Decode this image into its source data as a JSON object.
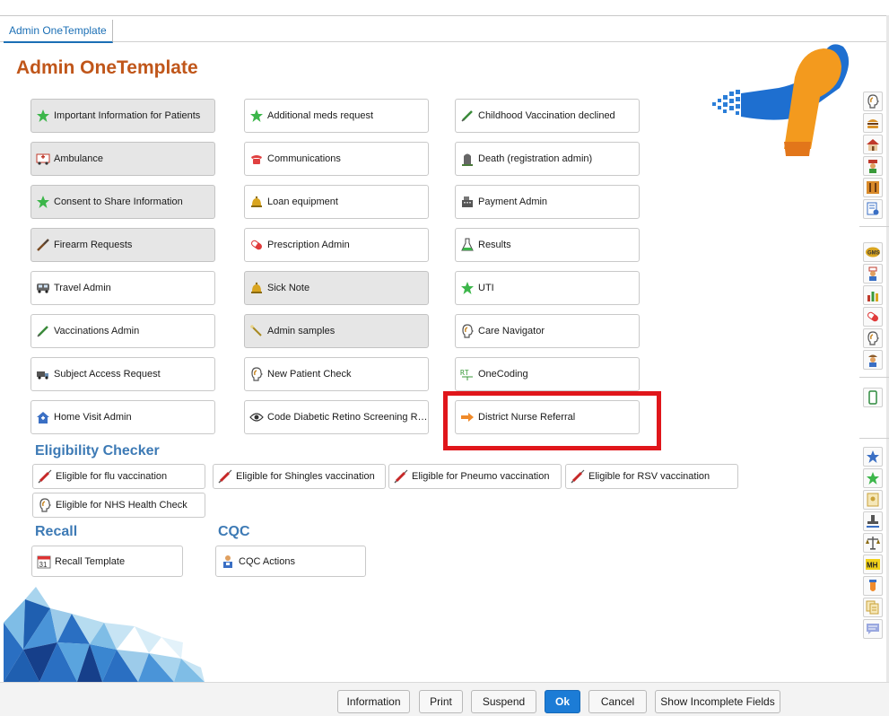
{
  "tab": {
    "label": "Admin OneTemplate"
  },
  "page": {
    "title": "Admin OneTemplate"
  },
  "grid_buttons": [
    {
      "label": "Important Information for Patients",
      "icon": "green-star-icon"
    },
    {
      "label": "Additional meds request",
      "icon": "green-star-icon"
    },
    {
      "label": "Childhood Vaccination declined",
      "icon": "syringe-icon"
    },
    {
      "label": "Ambulance",
      "icon": "ambulance-icon"
    },
    {
      "label": "Communications",
      "icon": "telephone-icon"
    },
    {
      "label": "Death (registration admin)",
      "icon": "gravestone-icon"
    },
    {
      "label": "Consent to Share Information",
      "icon": "green-star-icon"
    },
    {
      "label": "Loan equipment",
      "icon": "bell-icon"
    },
    {
      "label": "Payment Admin",
      "icon": "cash-register-icon"
    },
    {
      "label": "Firearm Requests",
      "icon": "rifle-icon"
    },
    {
      "label": "Prescription Admin",
      "icon": "pill-icon"
    },
    {
      "label": "Results",
      "icon": "flask-icon"
    },
    {
      "label": "Travel Admin",
      "icon": "bus-icon"
    },
    {
      "label": "Sick Note",
      "icon": "bell-icon"
    },
    {
      "label": "UTI",
      "icon": "green-star-icon"
    },
    {
      "label": "Vaccinations Admin",
      "icon": "syringe-icon"
    },
    {
      "label": "Admin samples",
      "icon": "swab-icon"
    },
    {
      "label": "Care Navigator",
      "icon": "head-profile-icon"
    },
    {
      "label": "Subject Access Request",
      "icon": "truck-icon"
    },
    {
      "label": "New Patient Check",
      "icon": "head-profile-icon"
    },
    {
      "label": "OneCoding",
      "icon": "coding-icon"
    },
    {
      "label": "Home Visit Admin",
      "icon": "home-visit-icon"
    },
    {
      "label": "Code Diabetic Retino Screening Re...",
      "icon": "eye-icon"
    },
    {
      "label": "District Nurse Referral",
      "icon": "orange-arrow-icon"
    }
  ],
  "eligibility": {
    "title": "Eligibility Checker",
    "buttons": [
      {
        "label": "Eligible for flu vaccination",
        "icon": "syringe-red-icon"
      },
      {
        "label": "Eligible for Shingles vaccination",
        "icon": "syringe-red-icon"
      },
      {
        "label": "Eligible for Pneumo vaccination",
        "icon": "syringe-red-icon"
      },
      {
        "label": "Eligible for RSV vaccination",
        "icon": "syringe-red-icon"
      },
      {
        "label": "Eligible for NHS Health Check",
        "icon": "head-profile-icon"
      }
    ]
  },
  "recall": {
    "title": "Recall",
    "button": {
      "label": "Recall Template",
      "icon": "calendar-icon",
      "calendar_day": "31"
    }
  },
  "cqc": {
    "title": "CQC",
    "button": {
      "label": "CQC Actions",
      "icon": "clipboard-person-icon"
    }
  },
  "right_icons_text": {
    "gms": "GMS",
    "mh": "MH"
  },
  "footer": {
    "information": "Information",
    "print": "Print",
    "suspend": "Suspend",
    "ok": "Ok",
    "cancel": "Cancel",
    "show_incomplete": "Show Incomplete Fields"
  },
  "colors": {
    "title": "#c0561a",
    "section": "#3d7ab5",
    "highlight": "#e0161b",
    "primary": "#1c7cd6"
  }
}
